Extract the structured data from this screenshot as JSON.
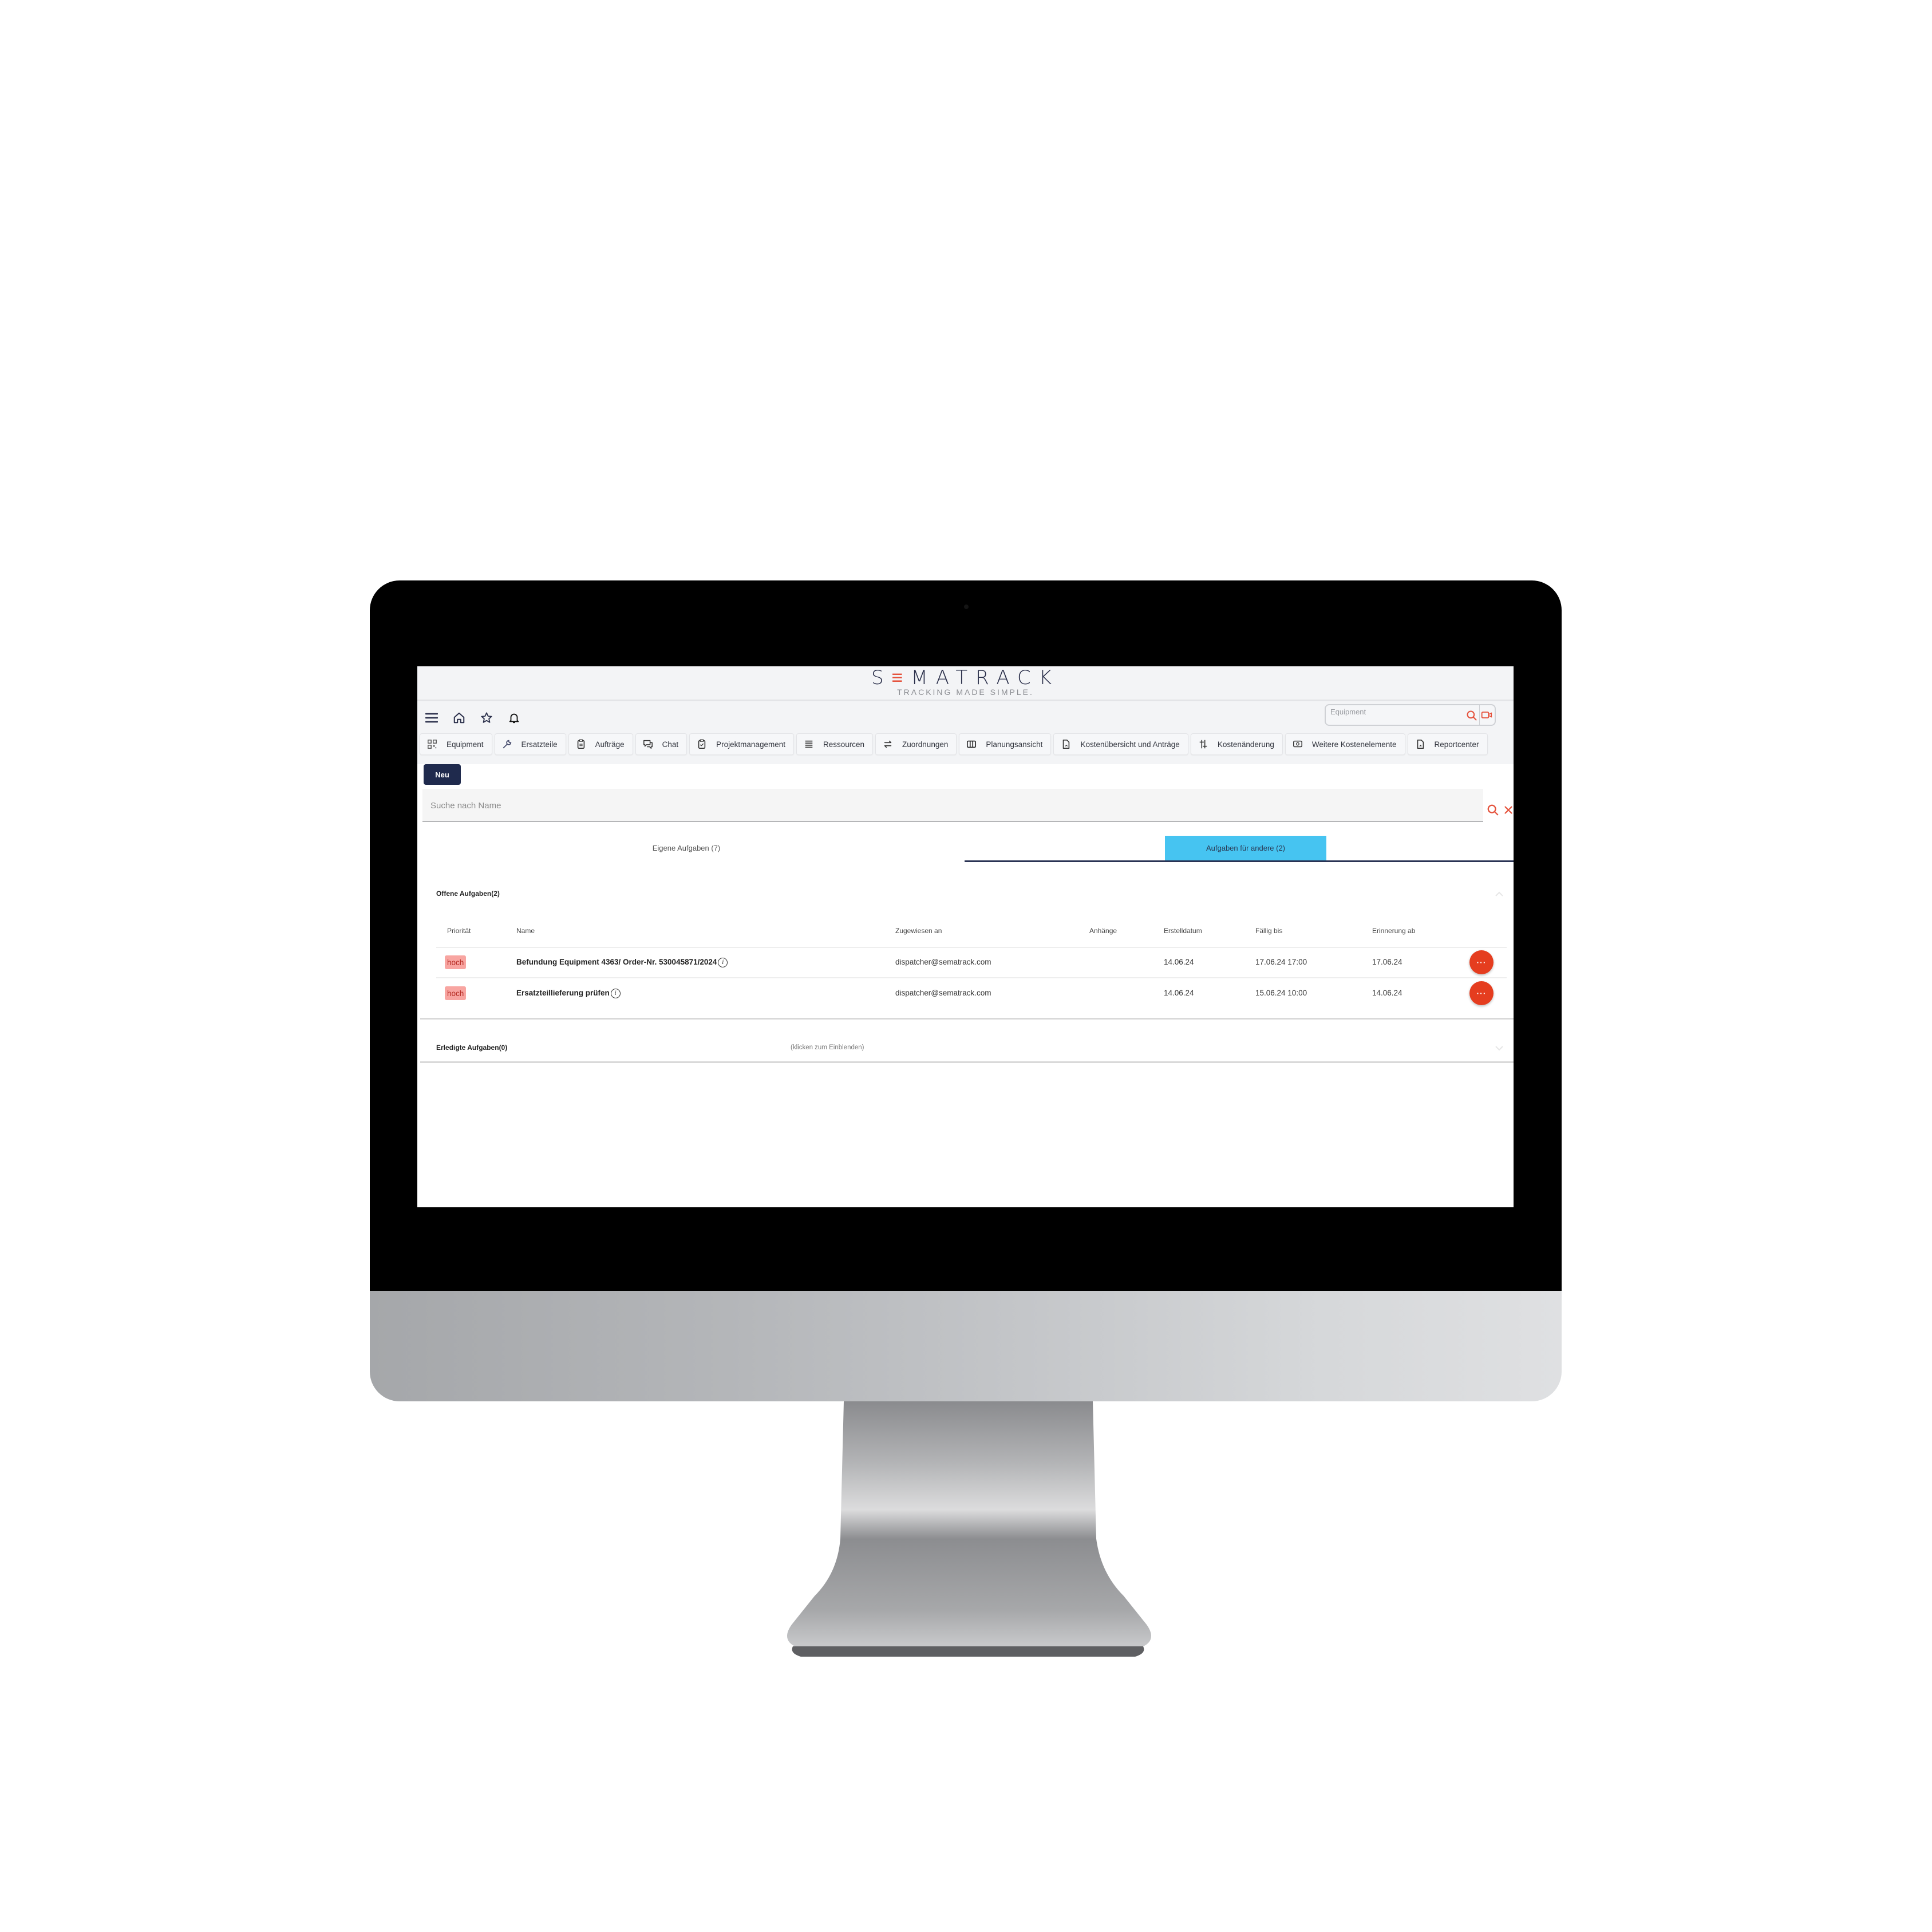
{
  "app": {
    "logo_prefix": "S",
    "logo_accent": "≡",
    "logo_suffix": "MATRACK",
    "tagline": "TRACKING MADE SIMPLE.",
    "brand_color": "#2a2f4a",
    "accent_color": "#e5533d"
  },
  "appbar": {
    "icons": [
      "menu-icon",
      "home-icon",
      "star-icon",
      "bell-icon"
    ],
    "equipment_search": {
      "placeholder": "Equipment",
      "value": ""
    }
  },
  "nav": {
    "tabs": [
      {
        "label": "Equipment",
        "icon": "qr-code-icon"
      },
      {
        "label": "Ersatzteile",
        "icon": "wrench-icon"
      },
      {
        "label": "Aufträge",
        "icon": "clipboard-icon"
      },
      {
        "label": "Chat",
        "icon": "chat-icon"
      },
      {
        "label": "Projektmanagement",
        "icon": "clipboard-check-icon"
      },
      {
        "label": "Ressourcen",
        "icon": "list-icon"
      },
      {
        "label": "Zuordnungen",
        "icon": "swap-icon"
      },
      {
        "label": "Planungsansicht",
        "icon": "columns-icon"
      },
      {
        "label": "Kostenübersicht und Anträge",
        "icon": "document-icon"
      },
      {
        "label": "Kostenänderung",
        "icon": "sliders-icon"
      },
      {
        "label": "Weitere Kostenelemente",
        "icon": "money-icon"
      },
      {
        "label": "Reportcenter",
        "icon": "report-icon"
      }
    ]
  },
  "toolbar": {
    "new_label": "Neu"
  },
  "name_search": {
    "placeholder": "Suche nach Name",
    "value": ""
  },
  "task_tabs": {
    "own": "Eigene Aufgaben (7)",
    "others": "Aufgaben für andere (2)",
    "active": "others",
    "active_color": "#46c4f1"
  },
  "open_tasks": {
    "title": "Offene Aufgaben(2)",
    "columns": [
      "Priorität",
      "Name",
      "Zugewiesen an",
      "Anhänge",
      "Erstelldatum",
      "Fällig bis",
      "Erinnerung ab"
    ],
    "rows": [
      {
        "priority": "hoch",
        "name": "Befundung Equipment 4363/ Order-Nr. 530045871/2024",
        "assigned_to": "dispatcher@sematrack.com",
        "attachments": "",
        "created": "14.06.24",
        "due": "17.06.24 17:00",
        "reminder": "17.06.24",
        "action_label": "···"
      },
      {
        "priority": "hoch",
        "name": "Ersatzteillieferung prüfen",
        "assigned_to": "dispatcher@sematrack.com",
        "attachments": "",
        "created": "14.06.24",
        "due": "15.06.24 10:00",
        "reminder": "14.06.24",
        "action_label": "···"
      }
    ]
  },
  "done_tasks": {
    "title": "Erledigte Aufgaben(0)",
    "hint": "(klicken zum Einblenden)"
  }
}
